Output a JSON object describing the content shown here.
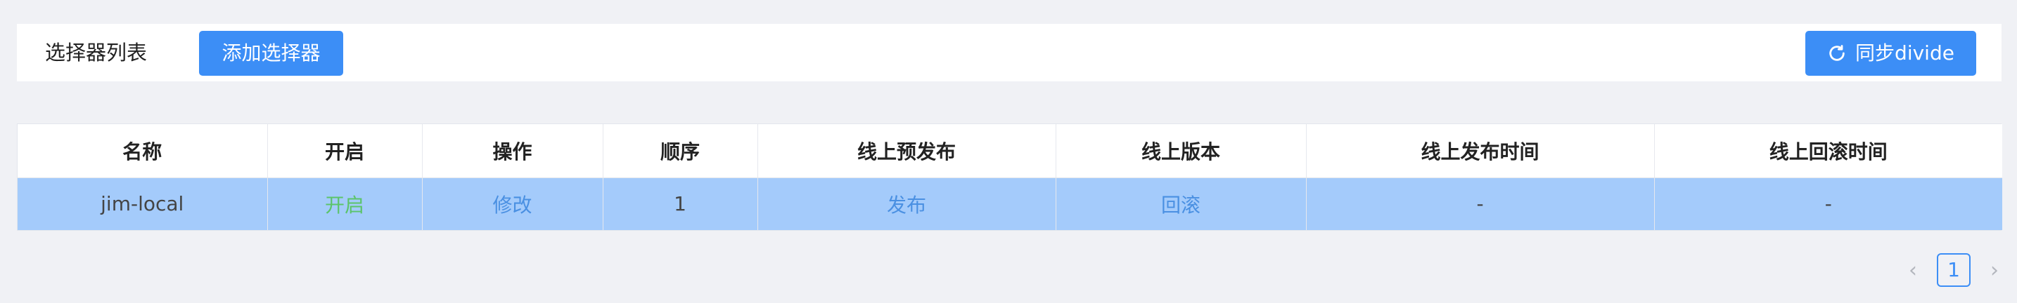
{
  "header": {
    "title": "选择器列表",
    "add_label": "添加选择器",
    "sync_label": "同步divide",
    "accent": "#3c8ef6"
  },
  "table": {
    "columns": [
      "名称",
      "开启",
      "操作",
      "顺序",
      "线上预发布",
      "线上版本",
      "线上发布时间",
      "线上回滚时间"
    ],
    "rows": [
      {
        "name": "jim-local",
        "enabled": "开启",
        "action": "修改",
        "order": "1",
        "prerelease": "发布",
        "version": "回滚",
        "publish_time": "-",
        "rollback_time": "-"
      }
    ],
    "selected_row_color": "#a4cbfb"
  },
  "pagination": {
    "prev_icon": "chevron-left-icon",
    "current_page": "1",
    "next_icon": "chevron-right-icon"
  }
}
